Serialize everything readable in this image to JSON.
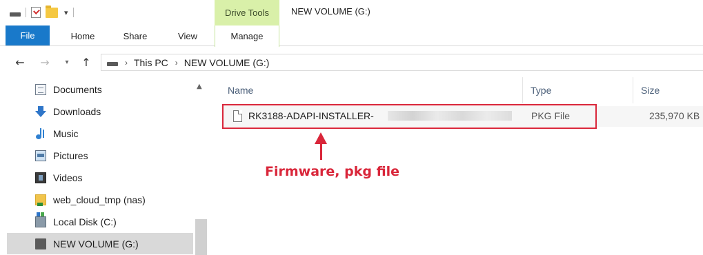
{
  "titlebar": {
    "contextual_tab": "Drive Tools",
    "window_title": "NEW VOLUME (G:)",
    "qat_dropdown": "▾"
  },
  "ribbon": {
    "tabs": [
      "File",
      "Home",
      "Share",
      "View",
      "Manage"
    ],
    "file_color": "#1979ca",
    "contextual_color": "#d9f0a9"
  },
  "navigation": {
    "back": "←",
    "forward": "→",
    "recent": "▾",
    "up": "↑",
    "separator": "›",
    "breadcrumbs": [
      "This PC",
      "NEW VOLUME (G:)"
    ]
  },
  "sidebar": {
    "items": [
      {
        "label": "Documents",
        "icon": "documents-icon"
      },
      {
        "label": "Downloads",
        "icon": "downloads-icon"
      },
      {
        "label": "Music",
        "icon": "music-icon"
      },
      {
        "label": "Pictures",
        "icon": "pictures-icon"
      },
      {
        "label": "Videos",
        "icon": "videos-icon"
      },
      {
        "label": "web_cloud_tmp (nas)",
        "icon": "network-drive-icon"
      },
      {
        "label": "Local Disk (C:)",
        "icon": "local-disk-icon"
      },
      {
        "label": "NEW VOLUME (G:)",
        "icon": "drive-icon",
        "selected": true
      }
    ],
    "scroll_up": "▲"
  },
  "file_list": {
    "columns": {
      "name": "Name",
      "type": "Type",
      "size": "Size"
    },
    "rows": [
      {
        "name": "RK3188-ADAPI-INSTALLER-",
        "type": "PKG File",
        "size": "235,970 KB",
        "name_redacted": true
      }
    ]
  },
  "annotation": {
    "text": "Firmware, pkg file",
    "color": "#d9263a"
  }
}
